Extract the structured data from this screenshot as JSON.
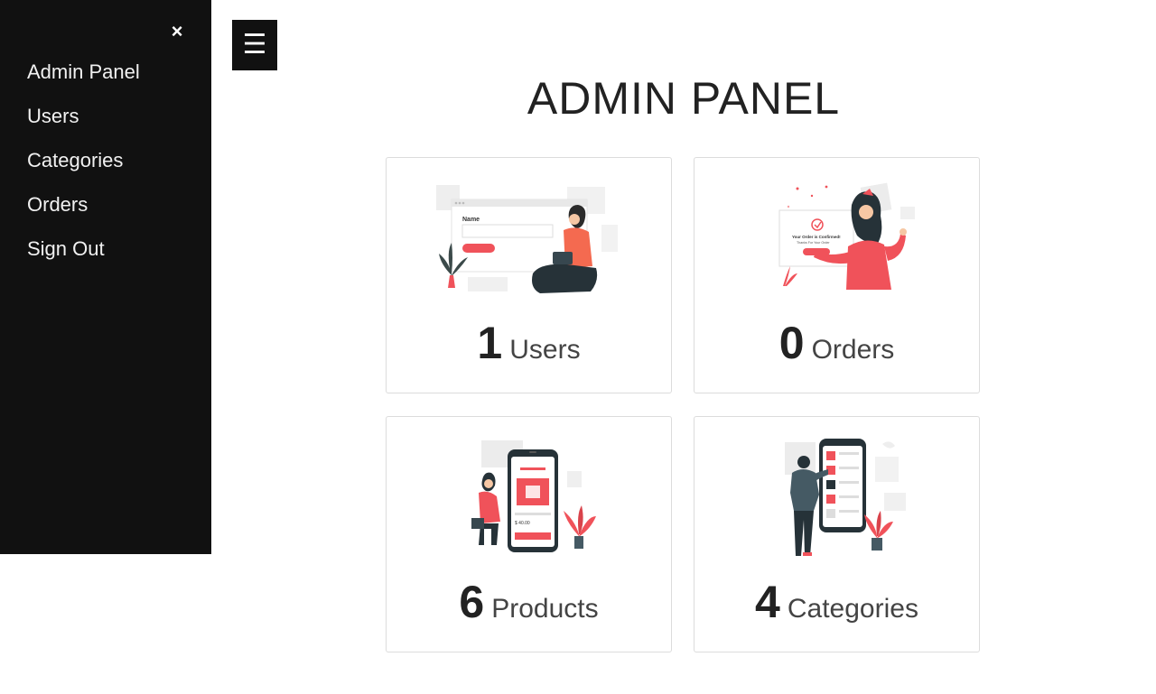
{
  "sidebar": {
    "close_label": "×",
    "items": [
      {
        "label": "Admin Panel"
      },
      {
        "label": "Users"
      },
      {
        "label": "Categories"
      },
      {
        "label": "Orders"
      },
      {
        "label": "Sign Out"
      }
    ]
  },
  "menu_button": {
    "label": "☰"
  },
  "page": {
    "title": "ADMIN PANEL"
  },
  "cards": [
    {
      "count": "1",
      "label": "Users",
      "illustration": "user-form-illustration"
    },
    {
      "count": "0",
      "label": "Orders",
      "illustration": "order-confirmed-illustration"
    },
    {
      "count": "6",
      "label": "Products",
      "illustration": "phone-shopping-illustration"
    },
    {
      "count": "4",
      "label": "Categories",
      "illustration": "category-browsing-illustration"
    }
  ],
  "illustration_text": {
    "name_field": "Name",
    "order_confirmed": "Your Order is Confirmed!",
    "order_thanks": "Thanks For Your Order",
    "price": "$ 40.00"
  },
  "colors": {
    "sidebar_bg": "#111111",
    "accent": "#f0525a",
    "text_dark": "#222222",
    "card_border": "#dcdcdc"
  }
}
